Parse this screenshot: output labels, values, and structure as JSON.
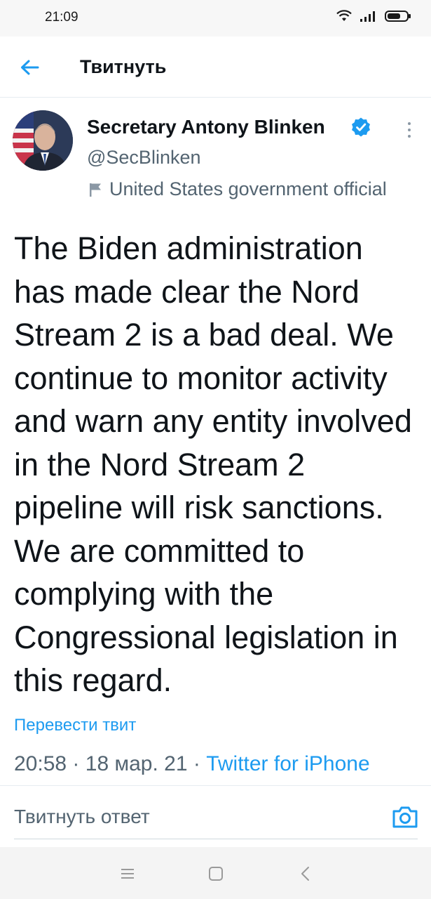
{
  "status_bar": {
    "time": "21:09",
    "icons": [
      "wifi-icon",
      "signal-icon",
      "battery-icon"
    ]
  },
  "header": {
    "back_icon": "arrow-left-icon",
    "title": "Твитнуть"
  },
  "tweet": {
    "author_name": "Secretary Antony Blinken",
    "handle": "@SecBlinken",
    "label": "United States government official",
    "text": "The Biden administration has made clear the Nord Stream 2 is a bad deal. We continue to monitor activity and warn any entity involved in the Nord Stream 2 pipeline will risk sanctions. We are committed to complying with the Congressional legislation in this regard.",
    "translate": "Перевести твит",
    "time": "20:58",
    "date": "18 мар. 21",
    "separator": "·",
    "source": "Twitter for iPhone"
  },
  "reply": {
    "placeholder": "Твитнуть ответ"
  },
  "colors": {
    "accent": "#1d9bf0",
    "text": "#0f1419",
    "secondary": "#536471"
  }
}
